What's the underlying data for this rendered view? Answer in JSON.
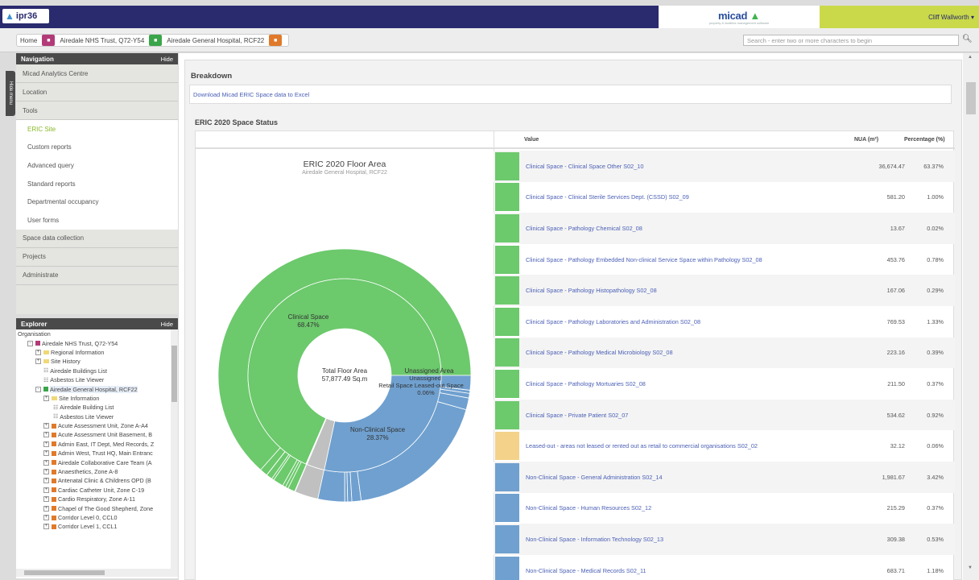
{
  "header": {
    "brand_text": "ipr36",
    "micad_logo": "micad",
    "micad_tagline": "property & facilities management software",
    "user": "Cliff Wallworth ▾"
  },
  "breadcrumb": {
    "home": "Home",
    "trust": "Airedale NHS Trust, Q72-Y54",
    "hospital": "Airedale General Hospital, RCF22"
  },
  "search": {
    "placeholder": "Search - enter two or more characters to begin"
  },
  "navigation": {
    "title": "Navigation",
    "hide": "Hide",
    "hide_menu": "Hide menu",
    "items": [
      {
        "label": "Micad Analytics Centre"
      },
      {
        "label": "Location"
      },
      {
        "label": "Tools"
      }
    ],
    "tools_sub": [
      {
        "label": "ERIC Site"
      },
      {
        "label": "Custom reports"
      },
      {
        "label": "Advanced query"
      },
      {
        "label": "Standard reports"
      },
      {
        "label": "Departmental occupancy"
      },
      {
        "label": "User forms"
      }
    ],
    "bottom_items": [
      {
        "label": "Space data collection"
      },
      {
        "label": "Projects"
      },
      {
        "label": "Administrate"
      }
    ]
  },
  "explorer": {
    "title": "Explorer",
    "hide": "Hide",
    "rows": [
      {
        "label": "Organisation"
      },
      {
        "label": "Airedale NHS Trust, Q72-Y54"
      },
      {
        "label": "Regional Information"
      },
      {
        "label": "Site History"
      },
      {
        "label": "Airedale Buildings List"
      },
      {
        "label": "Asbestos Lite Viewer"
      },
      {
        "label": "Airedale General Hospital, RCF22"
      },
      {
        "label": "Site Information"
      },
      {
        "label": "Airedale Building List"
      },
      {
        "label": "Asbestos Lite Viewer"
      },
      {
        "label": "Acute Assessment Unit, Zone A-A4"
      },
      {
        "label": "Acute Assessment Unit Basement, B"
      },
      {
        "label": "Admin East, IT Dept, Med Records, Z"
      },
      {
        "label": "Admin West, Trust HQ, Main Entranc"
      },
      {
        "label": "Airedale Collaborative Care Team (A"
      },
      {
        "label": "Anaesthetics, Zone A-8"
      },
      {
        "label": "Antenatal Clinic & Childrens OPD (B"
      },
      {
        "label": "Cardiac Catheter Unit, Zone C-19"
      },
      {
        "label": "Cardio Respiratory, Zone A-11"
      },
      {
        "label": "Chapel of The Good Shepherd, Zone"
      },
      {
        "label": "Corridor Level 0, CCL0"
      },
      {
        "label": "Corridor Level 1, CCL1"
      }
    ]
  },
  "main": {
    "breakdown_title": "Breakdown",
    "download_link": "Download Micad ERIC Space data to Excel",
    "section_title": "ERIC 2020 Space Status",
    "col_value": "Value",
    "col_nua": "NUA (m²)",
    "col_pct": "Percentage (%)"
  },
  "chart_data": {
    "type": "pie",
    "title": "ERIC 2020 Floor Area",
    "subtitle": "Airedale General Hospital, RCF22",
    "center_label": "Total Floor Area",
    "center_value": "57,877.49 Sq.m",
    "inner_ring": [
      {
        "name": "Clinical Space",
        "pct_label": "68.47%",
        "value": 68.47,
        "color": "#6cc96c"
      },
      {
        "name": "Unassigned Area",
        "pct_label": "",
        "value": 0.06,
        "color": "#f4d28a"
      },
      {
        "name": "Retail Space",
        "pct_label": "",
        "value": 0.06,
        "color": "#f4d28a"
      },
      {
        "name": "Leased-out Space",
        "pct_label": "0.06%",
        "value": 0.06,
        "color": "#f4d28a"
      },
      {
        "name": "Unassigned",
        "pct_label": "",
        "value": 3.0,
        "color": "#c0c0c0"
      },
      {
        "name": "Non-Clinical Space",
        "pct_label": "28.37%",
        "value": 28.37,
        "color": "#6fa0cf"
      }
    ],
    "outer_ring": [
      {
        "value": 63.37,
        "color": "#6cc96c"
      },
      {
        "value": 1.0,
        "color": "#6cc96c"
      },
      {
        "value": 0.02,
        "color": "#6cc96c"
      },
      {
        "value": 0.78,
        "color": "#6cc96c"
      },
      {
        "value": 0.29,
        "color": "#6cc96c"
      },
      {
        "value": 1.33,
        "color": "#6cc96c"
      },
      {
        "value": 0.39,
        "color": "#6cc96c"
      },
      {
        "value": 0.37,
        "color": "#6cc96c"
      },
      {
        "value": 0.92,
        "color": "#6cc96c"
      },
      {
        "value": 0.06,
        "color": "#f4d28a"
      },
      {
        "value": 3.0,
        "color": "#c0c0c0"
      },
      {
        "value": 3.42,
        "color": "#6fa0cf"
      },
      {
        "value": 0.37,
        "color": "#6fa0cf"
      },
      {
        "value": 0.53,
        "color": "#6fa0cf"
      },
      {
        "value": 1.18,
        "color": "#6fa0cf"
      },
      {
        "value": 18.5,
        "color": "#6fa0cf"
      },
      {
        "value": 1.5,
        "color": "#6fa0cf"
      },
      {
        "value": 0.6,
        "color": "#6fa0cf"
      },
      {
        "value": 0.4,
        "color": "#6fa0cf"
      },
      {
        "value": 1.87,
        "color": "#6fa0cf"
      }
    ],
    "rows": [
      {
        "label": "Clinical Space - Clinical Space Other S02_10",
        "nua": "36,674.47",
        "pct": "63.37%",
        "color": "#6cc96c"
      },
      {
        "label": "Clinical Space - Clinical Sterile Services Dept. (CSSD) S02_09",
        "nua": "581.20",
        "pct": "1.00%",
        "color": "#6cc96c"
      },
      {
        "label": "Clinical Space - Pathology Chemical S02_08",
        "nua": "13.67",
        "pct": "0.02%",
        "color": "#6cc96c"
      },
      {
        "label": "Clinical Space - Pathology Embedded Non-clinical Service Space within Pathology S02_08",
        "nua": "453.76",
        "pct": "0.78%",
        "color": "#6cc96c"
      },
      {
        "label": "Clinical Space - Pathology Histopathology S02_08",
        "nua": "167.06",
        "pct": "0.29%",
        "color": "#6cc96c"
      },
      {
        "label": "Clinical Space - Pathology Laboratories and Administration S02_08",
        "nua": "769.53",
        "pct": "1.33%",
        "color": "#6cc96c"
      },
      {
        "label": "Clinical Space - Pathology Medical Microbiology S02_08",
        "nua": "223.16",
        "pct": "0.39%",
        "color": "#6cc96c"
      },
      {
        "label": "Clinical Space - Pathology Mortuaries S02_08",
        "nua": "211.50",
        "pct": "0.37%",
        "color": "#6cc96c"
      },
      {
        "label": "Clinical Space - Private Patient S02_07",
        "nua": "534.62",
        "pct": "0.92%",
        "color": "#6cc96c"
      },
      {
        "label": "Leased-out - areas not leased or rented out as retail to commercial organisations S02_02",
        "nua": "32.12",
        "pct": "0.06%",
        "color": "#f4d28a"
      },
      {
        "label": "Non-Clinical Space - General Administration S02_14",
        "nua": "1,981.67",
        "pct": "3.42%",
        "color": "#6fa0cf"
      },
      {
        "label": "Non-Clinical Space - Human Resources S02_12",
        "nua": "215.29",
        "pct": "0.37%",
        "color": "#6fa0cf"
      },
      {
        "label": "Non-Clinical Space - Information Technology S02_13",
        "nua": "309.38",
        "pct": "0.53%",
        "color": "#6fa0cf"
      },
      {
        "label": "Non-Clinical Space - Medical Records S02_11",
        "nua": "683.71",
        "pct": "1.18%",
        "color": "#6fa0cf"
      }
    ]
  }
}
